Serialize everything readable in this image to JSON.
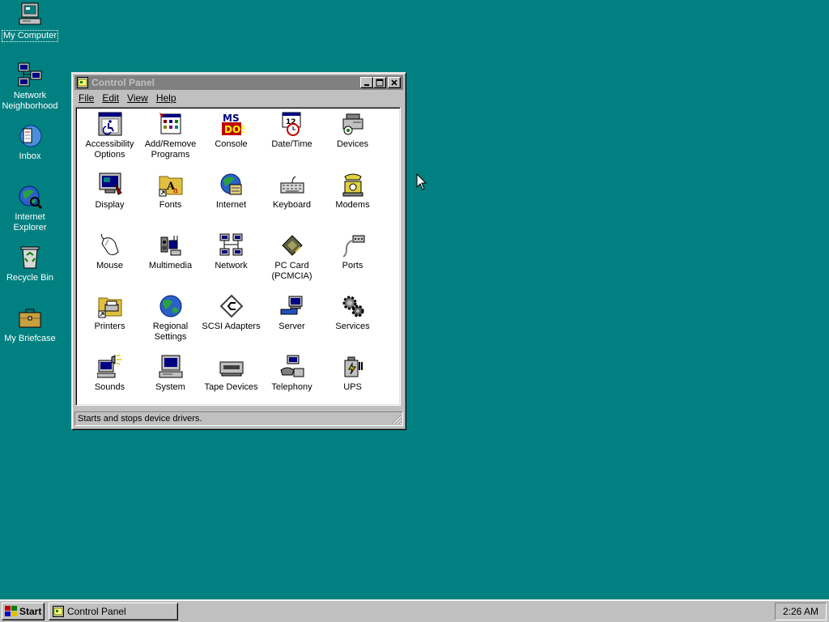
{
  "desktop": {
    "background": "#008080",
    "icons": [
      {
        "label": "My Computer",
        "icon": "my-computer-icon"
      },
      {
        "label": "Network Neighborhood",
        "icon": "network-neighborhood-icon"
      },
      {
        "label": "Inbox",
        "icon": "inbox-icon"
      },
      {
        "label": "Internet Explorer",
        "icon": "internet-explorer-icon"
      },
      {
        "label": "Recycle Bin",
        "icon": "recycle-bin-icon"
      },
      {
        "label": "My Briefcase",
        "icon": "briefcase-icon"
      }
    ]
  },
  "window": {
    "title": "Control Panel",
    "menu": [
      "File",
      "Edit",
      "View",
      "Help"
    ],
    "items": [
      {
        "label": "Accessibility Options",
        "icon": "accessibility-icon"
      },
      {
        "label": "Add/Remove Programs",
        "icon": "add-remove-programs-icon"
      },
      {
        "label": "Console",
        "icon": "console-icon"
      },
      {
        "label": "Date/Time",
        "icon": "date-time-icon"
      },
      {
        "label": "Devices",
        "icon": "devices-icon"
      },
      {
        "label": "Display",
        "icon": "display-icon"
      },
      {
        "label": "Fonts",
        "icon": "fonts-icon"
      },
      {
        "label": "Internet",
        "icon": "internet-icon"
      },
      {
        "label": "Keyboard",
        "icon": "keyboard-icon"
      },
      {
        "label": "Modems",
        "icon": "modems-icon"
      },
      {
        "label": "Mouse",
        "icon": "mouse-icon"
      },
      {
        "label": "Multimedia",
        "icon": "multimedia-icon"
      },
      {
        "label": "Network",
        "icon": "network-icon"
      },
      {
        "label": "PC Card (PCMCIA)",
        "icon": "pc-card-icon"
      },
      {
        "label": "Ports",
        "icon": "ports-icon"
      },
      {
        "label": "Printers",
        "icon": "printers-icon"
      },
      {
        "label": "Regional Settings",
        "icon": "regional-settings-icon"
      },
      {
        "label": "SCSI Adapters",
        "icon": "scsi-adapters-icon"
      },
      {
        "label": "Server",
        "icon": "server-icon"
      },
      {
        "label": "Services",
        "icon": "services-icon"
      },
      {
        "label": "Sounds",
        "icon": "sounds-icon"
      },
      {
        "label": "System",
        "icon": "system-icon"
      },
      {
        "label": "Tape Devices",
        "icon": "tape-devices-icon"
      },
      {
        "label": "Telephony",
        "icon": "telephony-icon"
      },
      {
        "label": "UPS",
        "icon": "ups-icon"
      }
    ],
    "status": "Starts and stops device drivers."
  },
  "taskbar": {
    "start_label": "Start",
    "tasks": [
      "Control Panel"
    ],
    "clock": "2:26 AM"
  }
}
